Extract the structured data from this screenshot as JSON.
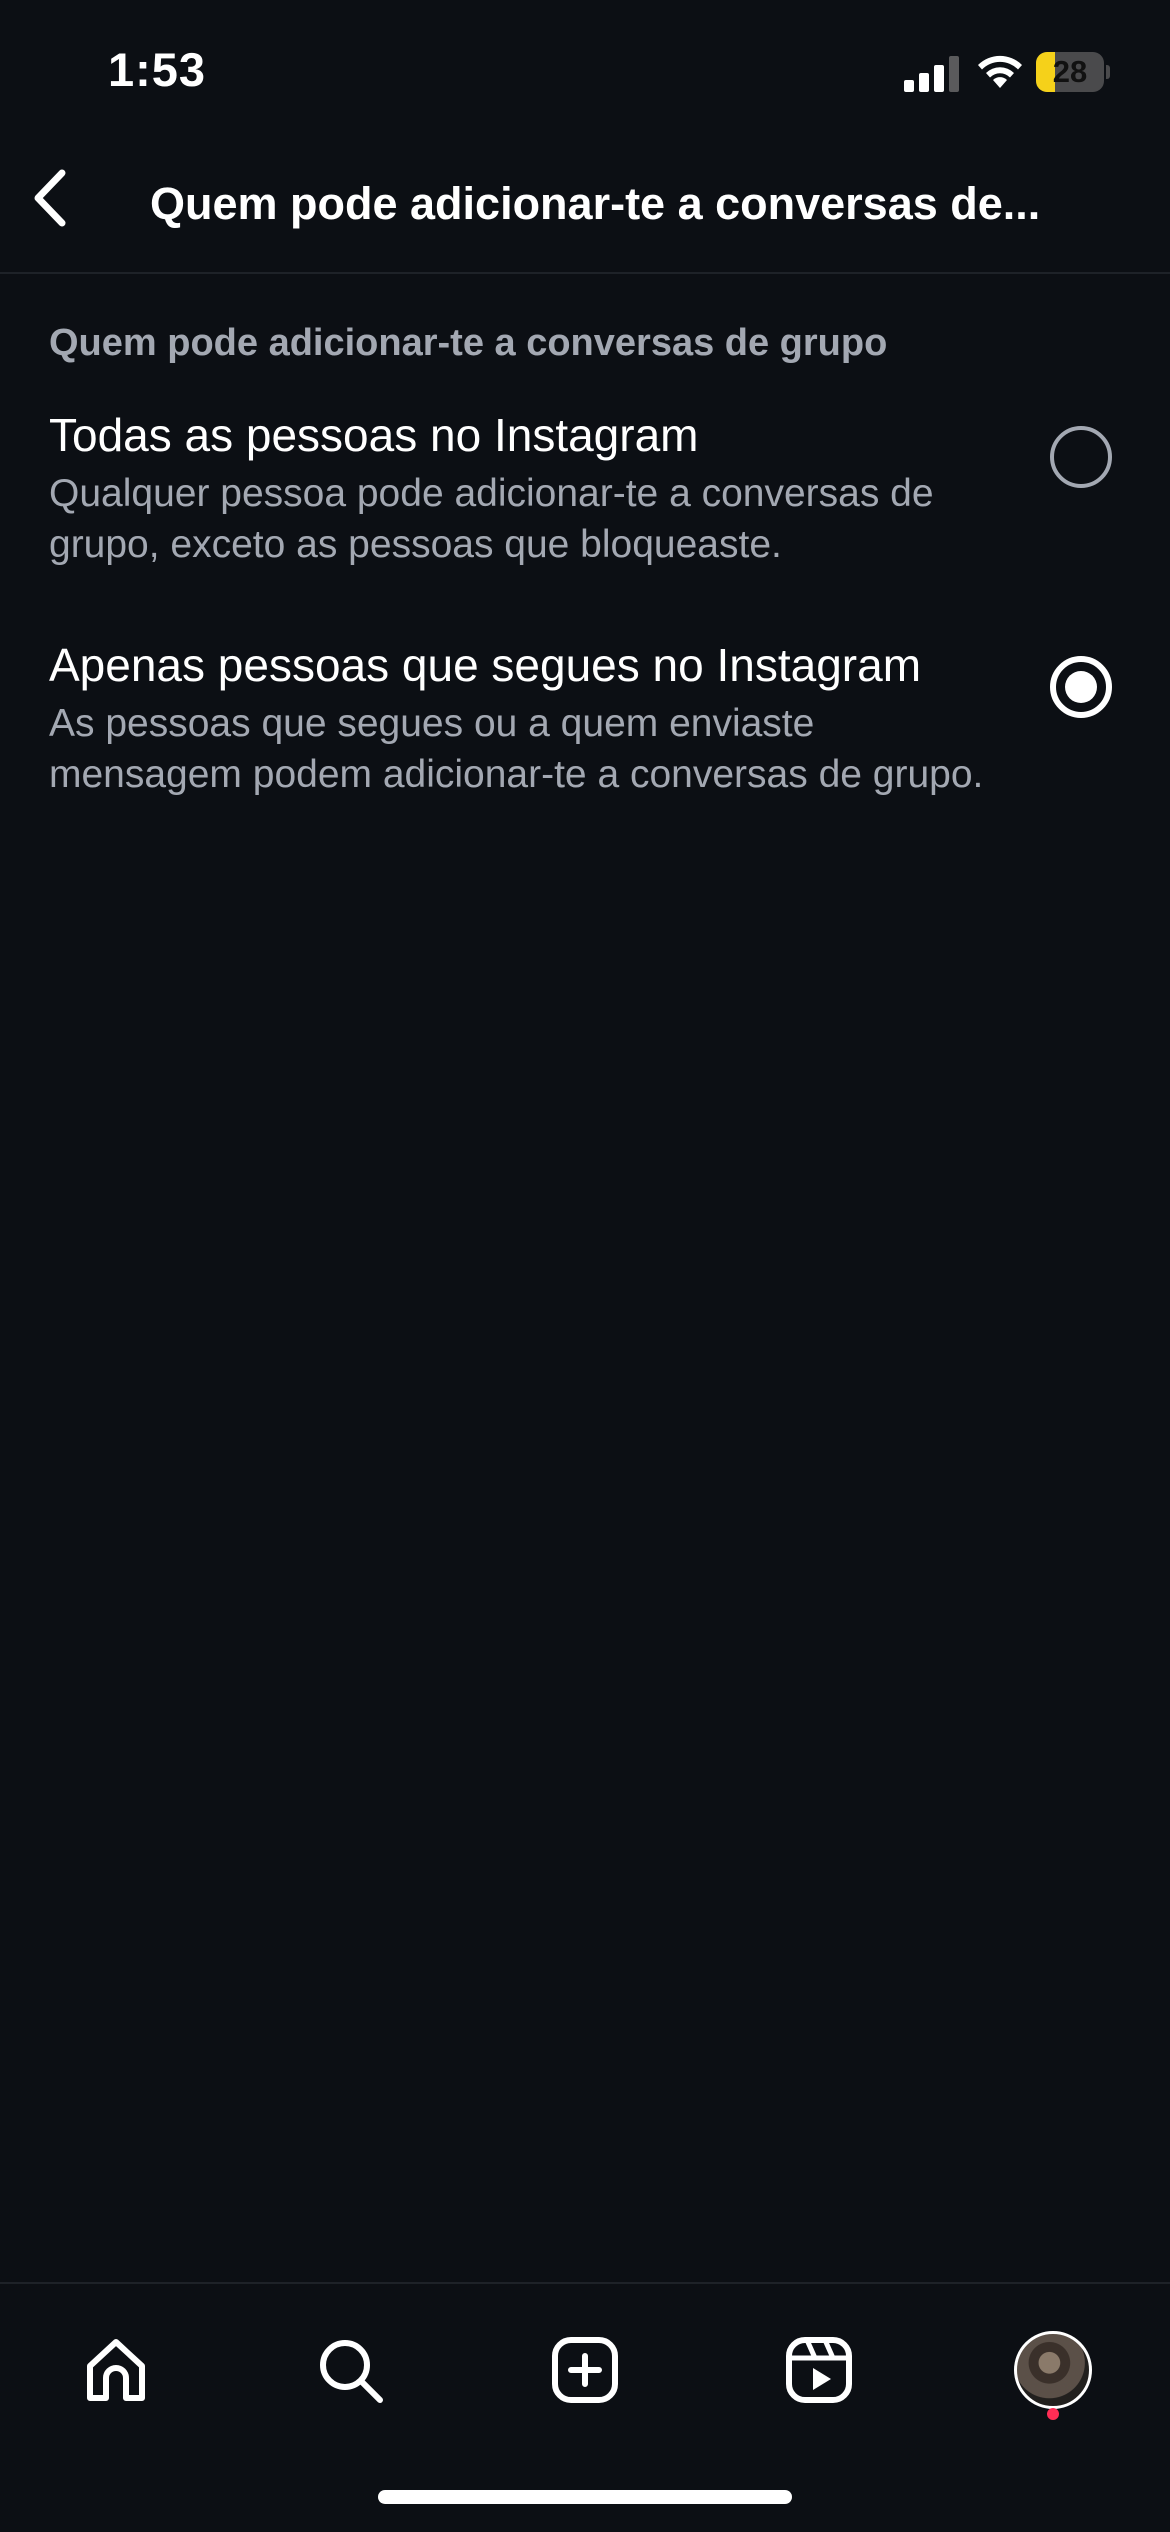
{
  "status_bar": {
    "time": "1:53",
    "battery_level": "28",
    "battery_fraction": 0.28,
    "battery_color": "#f5d11a"
  },
  "header": {
    "back_icon": "chevron-left-icon",
    "title": "Quem pode adicionar-te a conversas de..."
  },
  "section": {
    "title": "Quem pode adicionar-te a conversas de grupo"
  },
  "options": [
    {
      "title": "Todas as pessoas no Instagram",
      "description": "Qualquer pessoa pode adicionar-te a conversas de grupo, exceto as pessoas que bloqueaste.",
      "selected": false
    },
    {
      "title": "Apenas pessoas que segues no Instagram",
      "description": "As pessoas que segues ou a quem enviaste mensagem podem adicionar-te a conversas de grupo.",
      "selected": true
    }
  ],
  "tab_bar": {
    "tabs": [
      {
        "icon": "home-icon"
      },
      {
        "icon": "search-icon"
      },
      {
        "icon": "create-icon"
      },
      {
        "icon": "reels-icon"
      },
      {
        "icon": "profile-avatar",
        "has_notification": true
      }
    ],
    "notification_color": "#ff2d55"
  },
  "colors": {
    "background": "#0c0f14",
    "secondary_text": "#a3a8b2",
    "primary_text": "#ffffff"
  }
}
